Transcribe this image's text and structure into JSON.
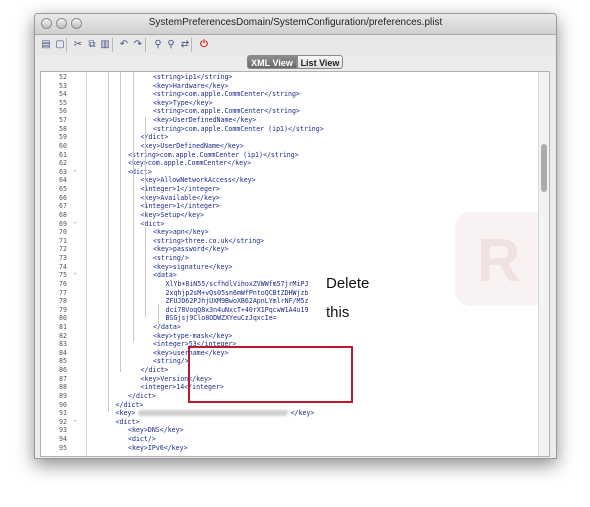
{
  "window": {
    "title": "SystemPreferencesDomain/SystemConfiguration/preferences.plist"
  },
  "toolbar": {
    "buttons": [
      {
        "name": "save-icon",
        "glyph": "▤"
      },
      {
        "name": "new-document-icon",
        "glyph": "▢"
      },
      {
        "name": "cut-icon",
        "glyph": "✂"
      },
      {
        "name": "copy-icon",
        "glyph": "⧉"
      },
      {
        "name": "paste-icon",
        "glyph": "▥"
      },
      {
        "name": "undo-icon",
        "glyph": "↶"
      },
      {
        "name": "redo-icon",
        "glyph": "↷"
      },
      {
        "name": "find-icon",
        "glyph": "⚲"
      },
      {
        "name": "find-next-icon",
        "glyph": "⚲"
      },
      {
        "name": "replace-icon",
        "glyph": "⇄"
      },
      {
        "name": "stop-icon",
        "glyph": "⏻"
      }
    ]
  },
  "view_tabs": {
    "active": "XML View",
    "inactive": "List View"
  },
  "annotation": {
    "line1": "Delete",
    "line2": "this"
  },
  "editor": {
    "lines": [
      {
        "n": "52",
        "text": "<string>ip1</string>",
        "fold": ""
      },
      {
        "n": "53",
        "text": "<key>Hardware</key>",
        "fold": ""
      },
      {
        "n": "54",
        "text": "<string>com.apple.CommCenter</string>",
        "fold": ""
      },
      {
        "n": "55",
        "text": "<key>Type</key>",
        "fold": ""
      },
      {
        "n": "56",
        "text": "<string>com.apple.CommCenter</string>",
        "fold": ""
      },
      {
        "n": "57",
        "text": "<key>UserDefinedName</key>",
        "fold": ""
      },
      {
        "n": "58",
        "text": "<string>com.apple.CommCenter (ip1)</string>",
        "fold": ""
      },
      {
        "n": "59",
        "text": "</dict>",
        "fold": ""
      },
      {
        "n": "60",
        "text": "<key>UserDefinedName</key>",
        "fold": ""
      },
      {
        "n": "61",
        "text": "<string>com.apple.CommCenter (ip1)</string>",
        "fold": ""
      },
      {
        "n": "62",
        "text": "<key>com.apple.CommCenter</key>",
        "fold": ""
      },
      {
        "n": "63",
        "text": "<dict>",
        "fold": "-"
      },
      {
        "n": "64",
        "text": "<key>AllowNetworkAccess</key>",
        "fold": ""
      },
      {
        "n": "65",
        "text": "<integer>1</integer>",
        "fold": ""
      },
      {
        "n": "66",
        "text": "<key>Available</key>",
        "fold": ""
      },
      {
        "n": "67",
        "text": "<integer>1</integer>",
        "fold": ""
      },
      {
        "n": "68",
        "text": "<key>Setup</key>",
        "fold": ""
      },
      {
        "n": "69",
        "text": "<dict>",
        "fold": "-"
      },
      {
        "n": "70",
        "text": "<key>apn</key>",
        "fold": ""
      },
      {
        "n": "71",
        "text": "<string>three.co.uk</string>",
        "fold": ""
      },
      {
        "n": "72",
        "text": "<key>password</key>",
        "fold": ""
      },
      {
        "n": "73",
        "text": "<string/>",
        "fold": ""
      },
      {
        "n": "74",
        "text": "<key>signature</key>",
        "fold": ""
      },
      {
        "n": "75",
        "text": "<data>",
        "fold": "-"
      },
      {
        "n": "76",
        "text": "XlYb+8iN55/scfhdlVihoxZVWWfm57jrMiPJ",
        "fold": ""
      },
      {
        "n": "77",
        "text": "2xqhjp2sM+vQs05sn6mWfPntoQCBtZDHWjzb",
        "fold": ""
      },
      {
        "n": "78",
        "text": "ZFUJD62PJhjUXM9BwoXB62ApnLYmlrNF/M5z",
        "fold": ""
      },
      {
        "n": "79",
        "text": "dci78VoqQ8x3n4uNxcT+40rX1PqcwW1A4u19",
        "fold": ""
      },
      {
        "n": "80",
        "text": "BSGjsj9Clo8ODWZXYeuCzJqxcIe=",
        "fold": ""
      },
      {
        "n": "81",
        "text": "</data>",
        "fold": ""
      },
      {
        "n": "82",
        "text": "<key>type-mask</key>",
        "fold": ""
      },
      {
        "n": "83",
        "text": "<integer>53</integer>",
        "fold": ""
      },
      {
        "n": "84",
        "text": "<key>username</key>",
        "fold": ""
      },
      {
        "n": "85",
        "text": "<string/>",
        "fold": ""
      },
      {
        "n": "86",
        "text": "</dict>",
        "fold": ""
      },
      {
        "n": "87",
        "text": "<key>Version</key>",
        "fold": ""
      },
      {
        "n": "88",
        "text": "<integer>14</integer>",
        "fold": ""
      },
      {
        "n": "89",
        "text": "</dict>",
        "fold": ""
      },
      {
        "n": "90",
        "text": "</dict>",
        "fold": ""
      },
      {
        "n": "91",
        "text": "<key>",
        "fold": ""
      },
      {
        "n": "92",
        "text": "<dict>",
        "fold": "-"
      },
      {
        "n": "93",
        "text": "<key>DNS</key>",
        "fold": ""
      },
      {
        "n": "94",
        "text": "<dict/>",
        "fold": ""
      },
      {
        "n": "95",
        "text": "<key>IPv6</key>",
        "fold": ""
      }
    ],
    "line_91_tail": "</key>"
  }
}
